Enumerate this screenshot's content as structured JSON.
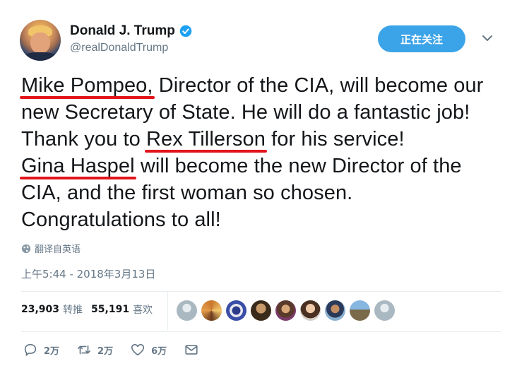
{
  "author": {
    "display_name": "Donald J. Trump",
    "handle": "@realDonaldTrump"
  },
  "follow_button": "正在关注",
  "tweet": {
    "seg1_hl": "Mike Pompeo,",
    "seg2": " Director of the CIA, will become our new Secretary of State. He will do a fantastic job! Thank you to ",
    "seg3_hl": "Rex Tillerson",
    "seg4": " for his service! ",
    "seg5_hl": "Gina Haspel",
    "seg6": " will become the new Director of the CIA, and the first woman so chosen. Congratulations to all!"
  },
  "translate_label": "翻译自英语",
  "timestamp": "上午5:44 - 2018年3月13日",
  "stats": {
    "retweets_count": "23,903",
    "retweets_label": "转推",
    "likes_count": "55,191",
    "likes_label": "喜欢"
  },
  "actions": {
    "reply_count": "2万",
    "retweet_count": "2万",
    "like_count": "6万"
  },
  "colors": {
    "follow_bg": "#3ba3e8",
    "verified": "#1da1f2",
    "underline": "#e3141a",
    "muted": "#657786"
  }
}
